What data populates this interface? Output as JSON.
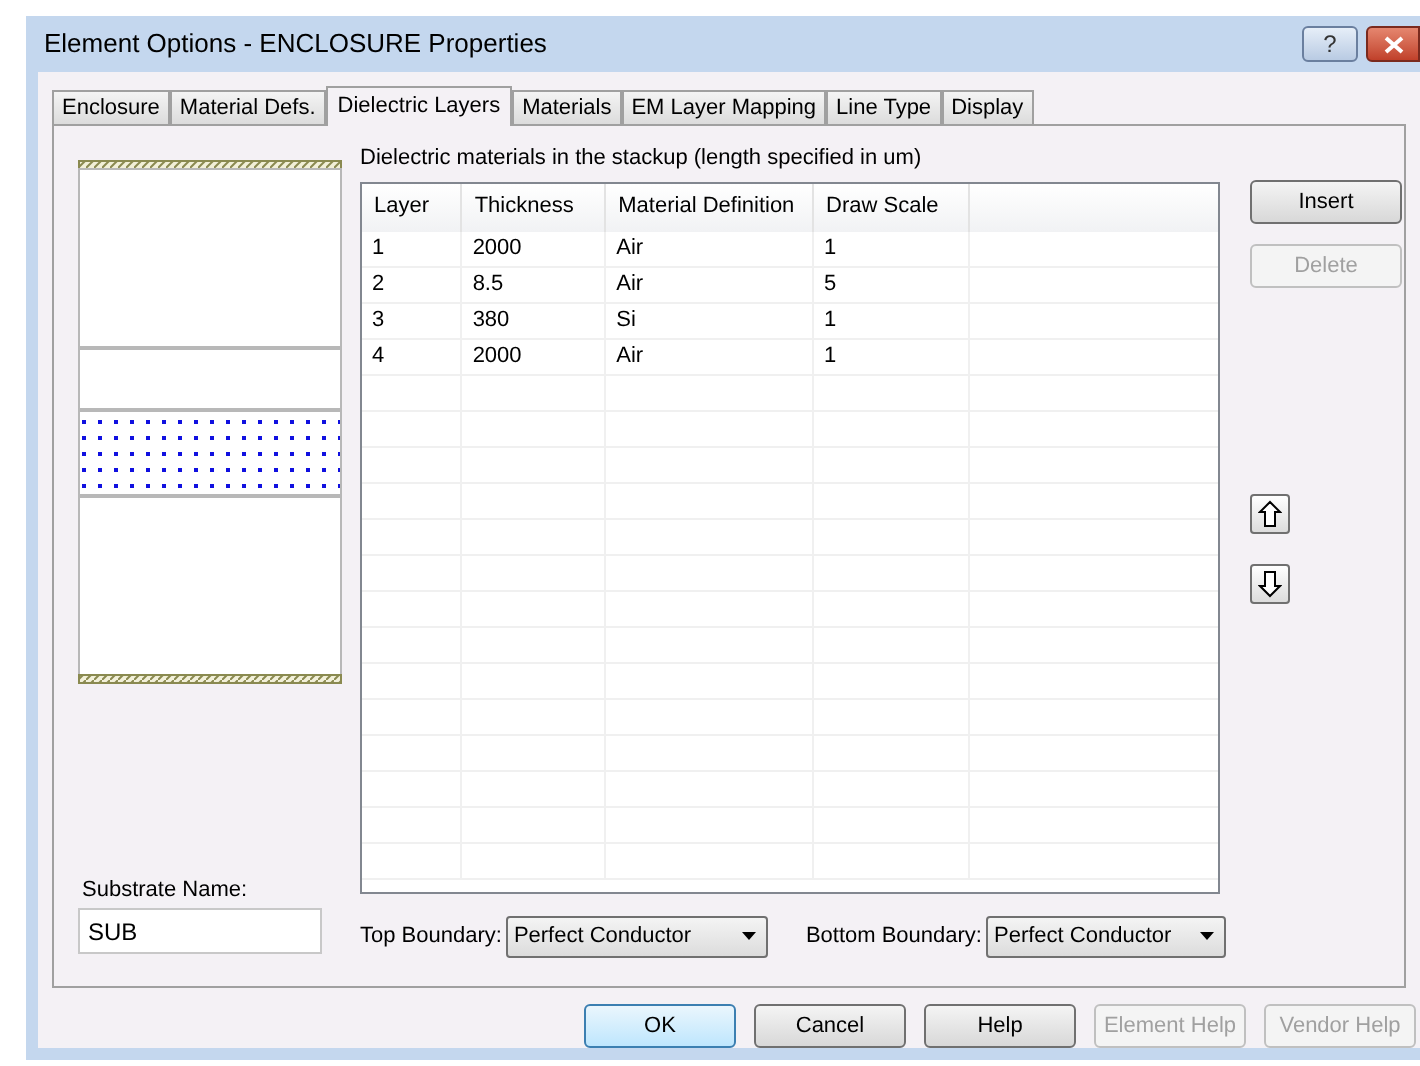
{
  "window": {
    "title": "Element Options - ENCLOSURE Properties",
    "help_button": "?"
  },
  "tabs": [
    {
      "label": "Enclosure",
      "selected": false
    },
    {
      "label": "Material Defs.",
      "selected": false
    },
    {
      "label": "Dielectric Layers",
      "selected": true
    },
    {
      "label": "Materials",
      "selected": false
    },
    {
      "label": "EM Layer Mapping",
      "selected": false
    },
    {
      "label": "Line Type",
      "selected": false
    },
    {
      "label": "Display",
      "selected": false
    }
  ],
  "table": {
    "caption": "Dielectric materials in the stackup (length specified in um)",
    "columns": [
      "Layer",
      "Thickness",
      "Material Definition",
      "Draw Scale"
    ],
    "rows": [
      [
        "1",
        "2000",
        "Air",
        "1"
      ],
      [
        "2",
        "8.5",
        "Air",
        "5"
      ],
      [
        "3",
        "380",
        "Si",
        "1"
      ],
      [
        "4",
        "2000",
        "Air",
        "1"
      ]
    ]
  },
  "side_buttons": [
    {
      "label": "Insert",
      "disabled": false
    },
    {
      "label": "Delete",
      "disabled": true
    }
  ],
  "substrate": {
    "label": "Substrate Name:",
    "value": "SUB"
  },
  "boundaries": [
    {
      "label": "Top Boundary:",
      "value": "Perfect Conductor"
    },
    {
      "label": "Bottom Boundary:",
      "value": "Perfect Conductor"
    }
  ],
  "buttons": [
    {
      "label": "OK",
      "disabled": false,
      "default": true
    },
    {
      "label": "Cancel",
      "disabled": false,
      "default": false
    },
    {
      "label": "Help",
      "disabled": false,
      "default": false
    },
    {
      "label": "Element Help",
      "disabled": true,
      "default": false
    },
    {
      "label": "Vendor Help",
      "disabled": true,
      "default": false
    }
  ]
}
